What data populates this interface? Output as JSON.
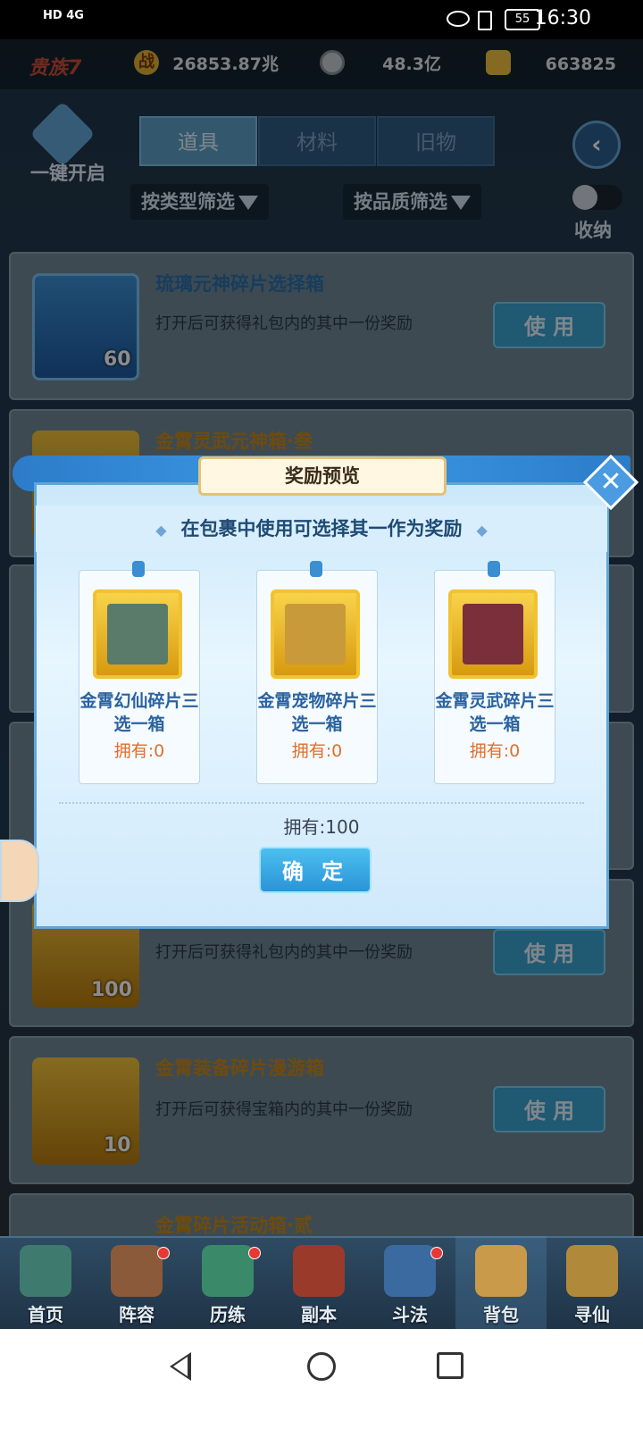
{
  "status_bar": {
    "left": "HD 4G",
    "battery": "55",
    "time": "16:30"
  },
  "header": {
    "rank": "贵族7",
    "power_icon": "战",
    "power": "26853.87兆",
    "silver": "48.3亿",
    "gold": "663825"
  },
  "toolbar": {
    "one_key_open": "一键开启",
    "tabs": [
      {
        "label": "道具"
      },
      {
        "label": "材料"
      },
      {
        "label": "旧物"
      }
    ],
    "filter_type": "按类型筛选",
    "filter_quality": "按品质筛选",
    "collapse": "收纳"
  },
  "items": [
    {
      "title": "琉璃元神碎片选择箱",
      "desc": "打开后可获得礼包内的其中一份奖励",
      "count": "60",
      "use": "使 用"
    },
    {
      "title": "金霄灵武元神箱·叁",
      "desc": "",
      "count": "",
      "use": ""
    },
    {
      "title": "",
      "desc": "打开后可获得礼包内的其中一份奖励",
      "count": "100",
      "use": "使 用"
    },
    {
      "title": "金霄装备碎片漫游箱",
      "desc": "打开后可获得宝箱内的其中一份奖励",
      "count": "10",
      "use": "使 用"
    },
    {
      "title": "金霄碎片活动箱·贰",
      "desc": "",
      "count": "",
      "use": ""
    }
  ],
  "dialog": {
    "title": "奖励预览",
    "subtitle": "在包裹中使用可选择其一作为奖励",
    "rewards": [
      {
        "name": "金霄幻仙碎片三选一箱",
        "own": "拥有:0"
      },
      {
        "name": "金霄宠物碎片三选一箱",
        "own": "拥有:0"
      },
      {
        "name": "金霄灵武碎片三选一箱",
        "own": "拥有:0"
      }
    ],
    "total": "拥有:100",
    "confirm": "确 定",
    "close_glyph": "✕"
  },
  "bottom_nav": [
    {
      "label": "首页"
    },
    {
      "label": "阵容"
    },
    {
      "label": "历练"
    },
    {
      "label": "副本"
    },
    {
      "label": "斗法"
    },
    {
      "label": "背包"
    },
    {
      "label": "寻仙"
    }
  ],
  "colors": {
    "accent": "#3aa2cf",
    "gold": "#f1c232",
    "warning": "#e0702b"
  }
}
